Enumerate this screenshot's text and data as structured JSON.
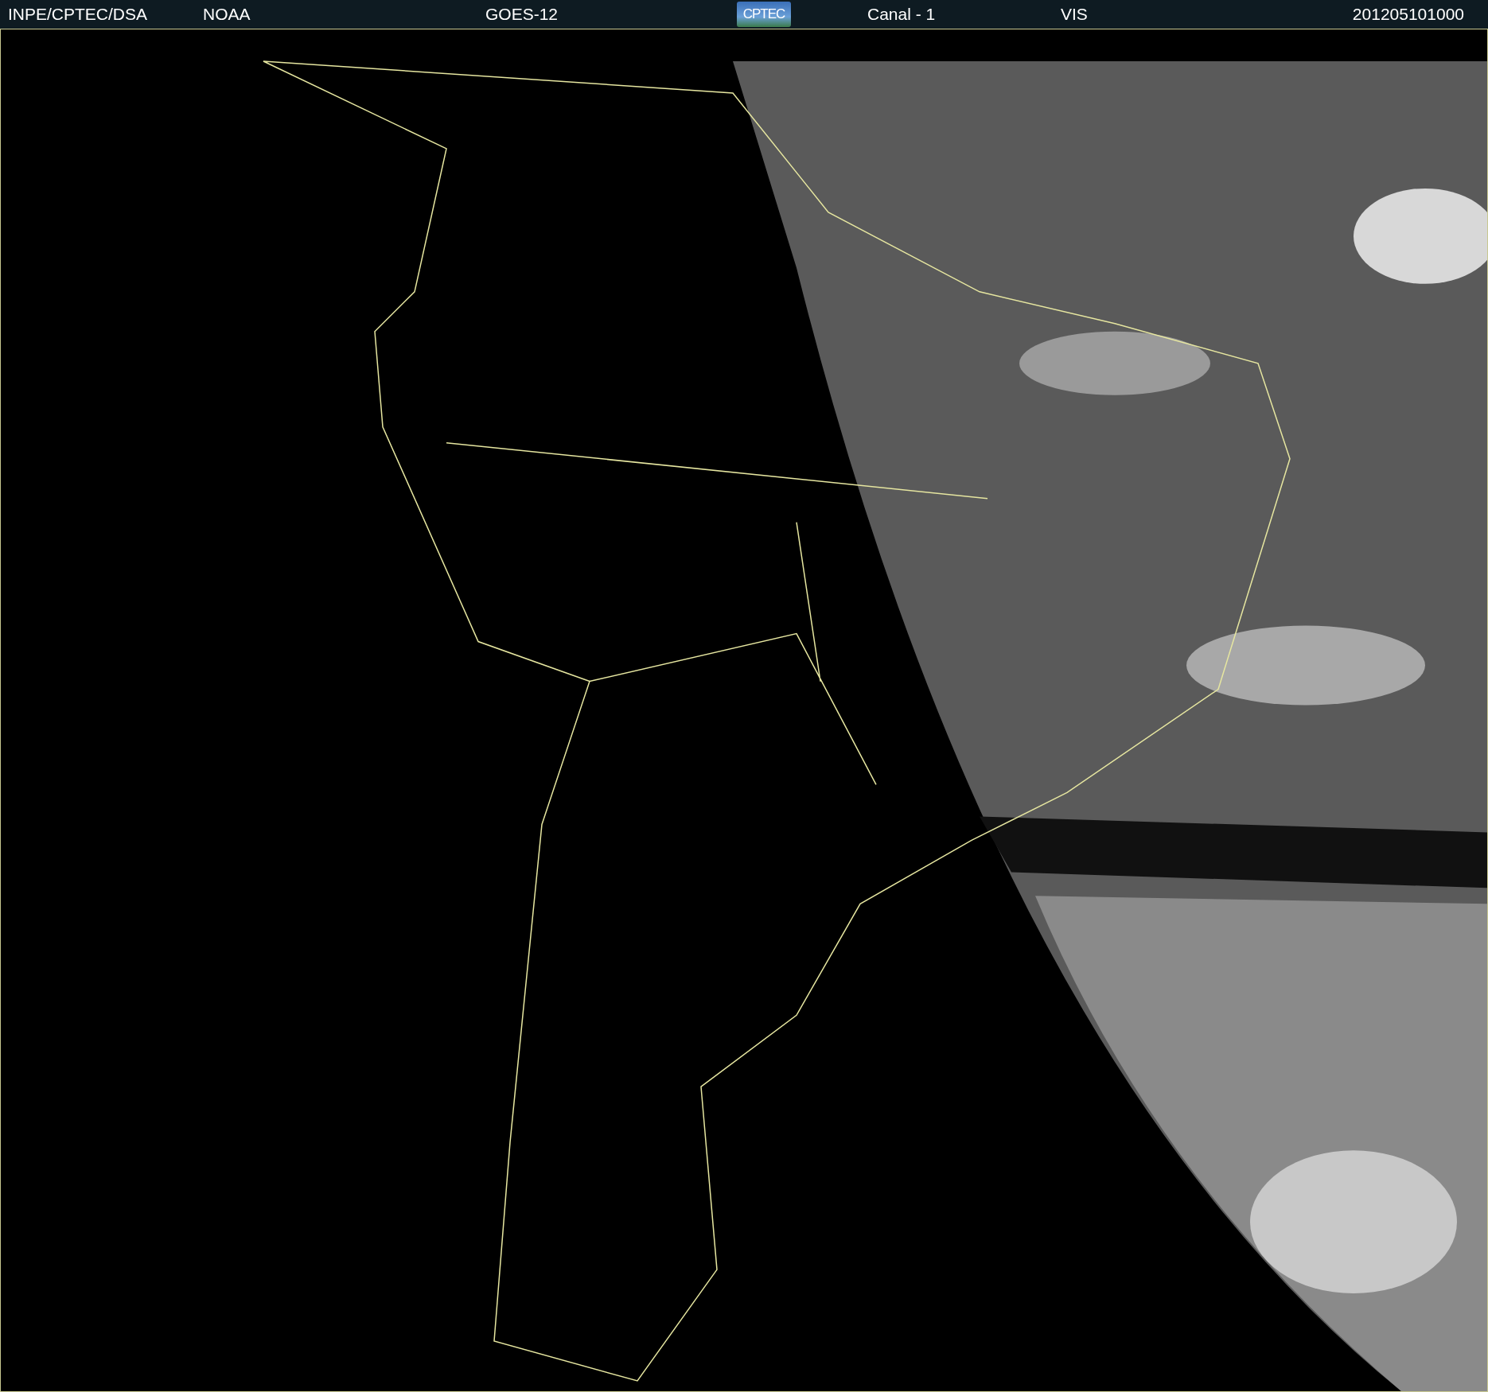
{
  "header": {
    "source": "INPE/CPTEC/DSA",
    "agency": "NOAA",
    "satellite": "GOES-12",
    "logo": "CPTEC",
    "channel": "Canal - 1",
    "band": "VIS",
    "timestamp": "201205101000"
  }
}
